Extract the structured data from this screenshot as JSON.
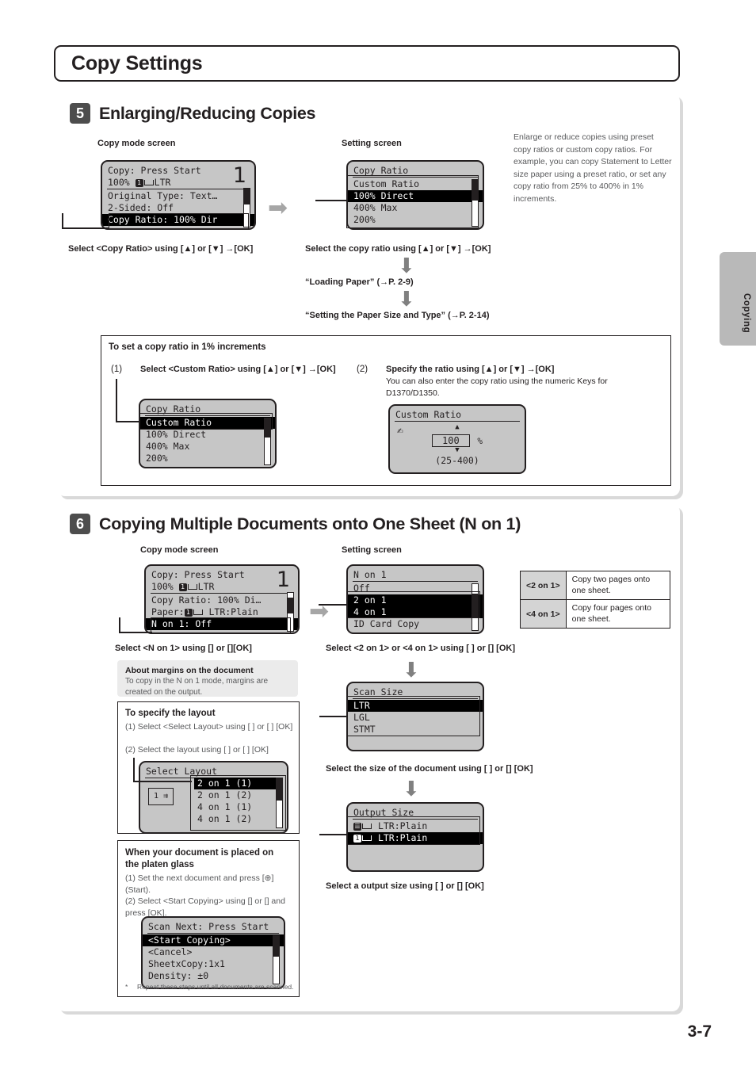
{
  "page": {
    "title": "Copy Settings",
    "folio": "3-7",
    "side_tab_label": "Copying"
  },
  "section5": {
    "number": "5",
    "heading": "Enlarging/Reducing Copies",
    "caption_left": "Copy mode screen",
    "caption_right": "Setting screen",
    "note": "Enlarge or reduce copies using preset copy ratios or custom copy ratios. For example, you can copy Statement to Letter size paper using a preset ratio, or set any copy ratio from 25% to 400% in 1% increments.",
    "copy_mode_screen": {
      "line1": "Copy: Press Start",
      "line2_prefix": "100%",
      "line2_suffix": "LTR",
      "big_number": "1",
      "line3": "Original Type: Text…",
      "line4": "2-Sided: Off",
      "line5_highlight": "Copy Ratio: 100% Dir"
    },
    "setting_screen": {
      "title": "Copy Ratio",
      "items": [
        "Custom Ratio",
        "100% Direct",
        "400% Max",
        "200%"
      ],
      "selected_index": 1
    },
    "step_left": "Select <Copy Ratio> using [▲] or [▼] →[OK]",
    "step_right": "Select the copy ratio using [▲] or [▼] →[OK]",
    "flow1": "“Loading Paper” (→P. 2-9)",
    "flow2": "“Setting the Paper Size and Type” (→P. 2-14)",
    "increments_box": {
      "title": "To set a copy ratio in 1% increments",
      "step1_num": "(1)",
      "step1_text": "Select <Custom Ratio> using [▲] or [▼] →[OK]",
      "step2_num": "(2)",
      "step2_line1": "Specify the ratio using [▲] or [▼] →[OK]",
      "step2_line2": "You can also enter the copy ratio using the numeric Keys for D1370/D1350.",
      "copy_ratio_screen": {
        "title": "Copy Ratio",
        "items": [
          "Custom Ratio",
          "100% Direct",
          "400% Max",
          "200%"
        ],
        "selected_index": 0
      },
      "custom_ratio_screen": {
        "title": "Custom Ratio",
        "value": "100",
        "unit": "%",
        "range": "(25-400)"
      }
    }
  },
  "section6": {
    "number": "6",
    "heading": "Copying Multiple Documents onto One Sheet (N on 1)",
    "caption_left": "Copy mode screen",
    "caption_right": "Setting screen",
    "copy_mode_screen": {
      "line1": "Copy: Press Start",
      "line2_prefix": "100%",
      "line2_suffix": "LTR",
      "big_number": "1",
      "line3": "Copy Ratio: 100% Di…",
      "line4_prefix": "Paper:",
      "line4_suffix": "LTR:Plain",
      "line5_highlight": "N on 1: Off"
    },
    "n_on_1_screen": {
      "title": "N on 1",
      "items": [
        "Off",
        "2 on 1",
        "4 on 1",
        "ID Card Copy"
      ],
      "selected_indexes": [
        1,
        2
      ]
    },
    "table": {
      "rows": [
        {
          "key": "<2 on 1>",
          "value": "Copy two pages onto one sheet."
        },
        {
          "key": "<4 on 1>",
          "value": "Copy four pages onto one sheet."
        }
      ]
    },
    "step_left": "Select <N on 1> using [] or [][OK]",
    "step_right": "Select <2 on 1> or <4 on 1> using [   ] or []        [OK]",
    "margins_note": {
      "title": "About margins on the document",
      "body": "To copy in the N on 1 mode, margins are created on the output."
    },
    "layout_box": {
      "title": "To specify the layout",
      "line1": "(1) Select <Select Layout> using [    ] or [    ] [OK]",
      "line2": "(2) Select the layout using [    ] or [    ] [OK]",
      "screen": {
        "title": "Select Layout",
        "items": [
          "2 on 1 (1)",
          "2 on 1 (2)",
          "4 on 1 (1)",
          "4 on 1 (2)"
        ],
        "selected_index": 0,
        "icon_label": "1"
      }
    },
    "platen_box": {
      "title": "When your document is placed on the platen glass",
      "line1": "(1) Set the next document and press [⊕] (Start).",
      "line2": "(2) Select <Start Copying> using [] or [] and press [OK].",
      "screen": {
        "title": "Scan Next: Press Start",
        "items": [
          "<Start Copying>",
          "<Cancel>",
          "SheetxCopy:1x1",
          "Density: ±0"
        ],
        "selected_index": 0
      },
      "footnote_mark": "*",
      "footnote": "Repeat these steps until all documents are scanned."
    },
    "scan_size_screen": {
      "title": "Scan Size",
      "items": [
        "LTR",
        "LGL",
        "STMT"
      ],
      "selected_index": 0
    },
    "scan_size_step": "Select the size of the document using [    ] or []        [OK]",
    "output_size_screen": {
      "title": "Output Size",
      "items": [
        "LTR:Plain",
        "LTR:Plain"
      ],
      "selected_index": 1
    },
    "output_size_step": "Select a output size using [    ] or []        [OK]"
  }
}
